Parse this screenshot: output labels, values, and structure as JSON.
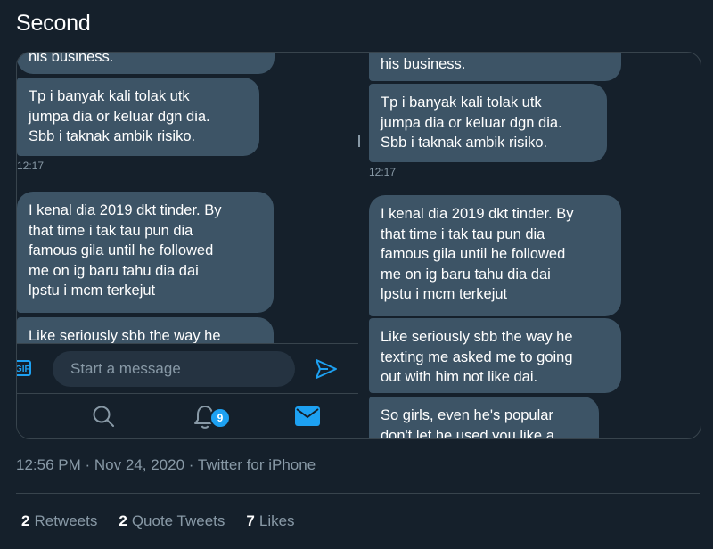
{
  "tweet": {
    "text": "Second",
    "meta": {
      "time": "12:56 PM",
      "date": "Nov 24, 2020",
      "source": "Twitter for iPhone",
      "separator": "·"
    },
    "stats": [
      {
        "count": "2",
        "label": "Retweets"
      },
      {
        "count": "2",
        "label": "Quote Tweets"
      },
      {
        "count": "7",
        "label": "Likes"
      }
    ]
  },
  "left_shot": {
    "messages": [
      {
        "text": "his business."
      },
      {
        "text": "Tp i banyak kali tolak utk\njumpa dia or keluar dgn dia.\nSbb i taknak ambik risiko."
      },
      {
        "text": "I kenal dia 2019 dkt tinder. By\nthat time i tak tau pun dia\nfamous gila until he followed\nme on ig baru tahu dia dai\nlpstu i mcm terkejut"
      },
      {
        "text": "Like seriously sbb the way he"
      }
    ],
    "timestamp": "12:17",
    "composer": {
      "gif_label": "GIF",
      "placeholder": "Start a message"
    },
    "tabbar": {
      "notification_badge": "9",
      "icons": [
        "search-icon",
        "bell-icon",
        "mail-icon"
      ]
    }
  },
  "right_shot": {
    "messages": [
      {
        "text": "his business."
      },
      {
        "text": "Tp i banyak kali tolak utk\njumpa dia or keluar dgn dia.\nSbb i taknak ambik risiko."
      },
      {
        "text": "I kenal dia 2019 dkt tinder. By\nthat time i tak tau pun dia\nfamous gila until he followed\nme on ig baru tahu dia dai\nlpstu i mcm terkejut"
      },
      {
        "text": "Like seriously sbb the way he\ntexting me asked me to going\nout with him not like dai."
      },
      {
        "text": "So girls, even he's popular\ndon't let he used you like a"
      }
    ],
    "timestamp": "12:17"
  },
  "colors": {
    "background": "#15202b",
    "bubble": "#3d5466",
    "accent": "#1da1f2",
    "secondary_text": "#8899a6",
    "border": "#38444d"
  }
}
